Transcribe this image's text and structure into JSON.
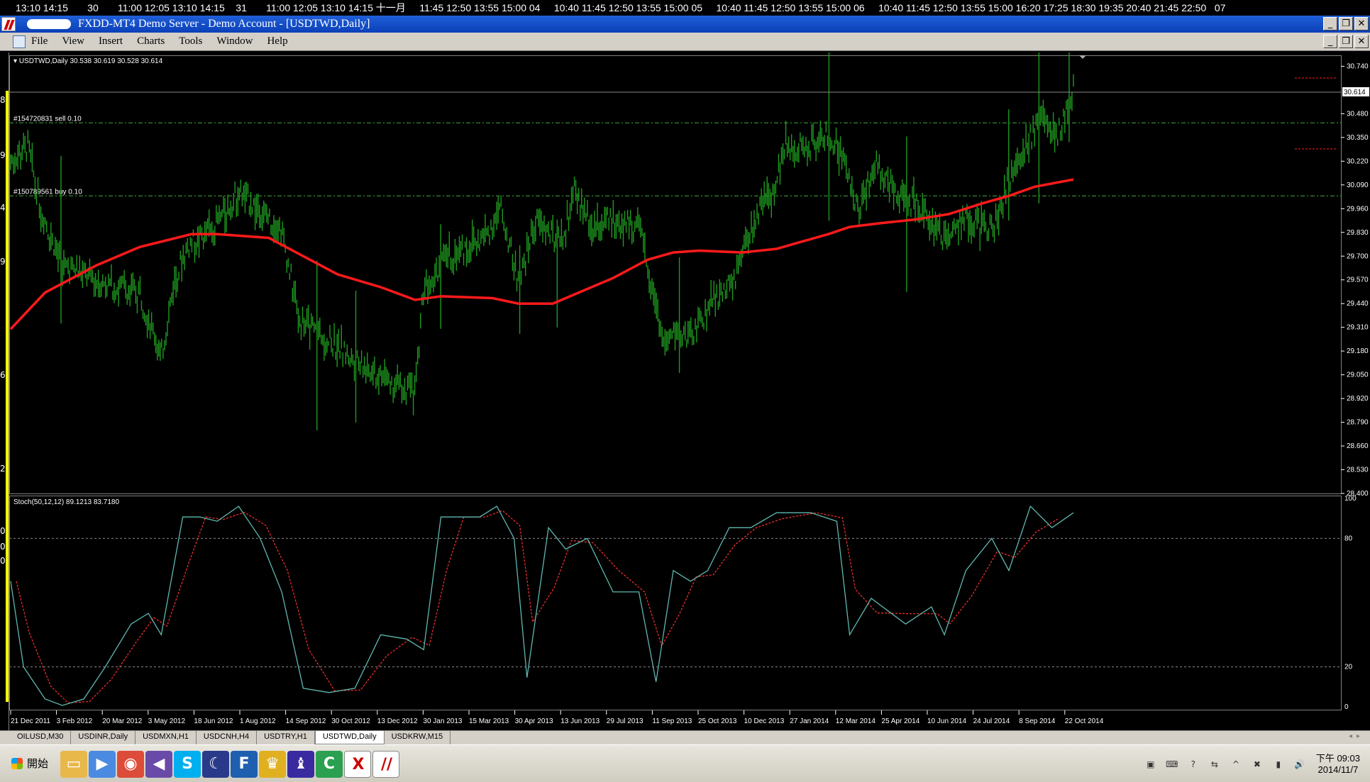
{
  "background_strip": {
    "text": "13:10 14:15       30       11:00 12:05 13:10 14:15    31       11:00 12:05 13:10 14:15 十一月     11:45 12:50 13:55 15:00 04     10:40 11:45 12:50 13:55 15:00 05     10:40 11:45 12:50 13:55 15:00 06     10:40 11:45 12:50 13:55 15:00 16:20 17:25 18:30 19:35 20:40 21:45 22:50   07"
  },
  "window": {
    "title": "FXDD-MT4 Demo Server - Demo Account - [USDTWD,Daily]",
    "buttons": [
      "_",
      "❐",
      "✕"
    ]
  },
  "menubar": {
    "items": [
      "File",
      "View",
      "Insert",
      "Charts",
      "Tools",
      "Window",
      "Help"
    ],
    "mdi_buttons": [
      "_",
      "❐",
      "✕"
    ]
  },
  "left_rail_fragments": [
    "8",
    "9",
    "4",
    "9",
    "6",
    "2",
    "0",
    "0",
    "0"
  ],
  "chart": {
    "symbol_info": "USDTWD,Daily  30.538 30.619 30.528 30.614",
    "current_price": "30.614",
    "order_lines": [
      {
        "label": "#154720831 sell 0.10",
        "price": 30.43
      },
      {
        "label": "#150789561 buy 0.10",
        "price": 30.03
      }
    ],
    "price_axis": [
      "30.740",
      "30.480",
      "30.350",
      "30.220",
      "30.090",
      "29.960",
      "29.830",
      "29.700",
      "29.570",
      "29.440",
      "29.310",
      "29.180",
      "29.050",
      "28.920",
      "28.790",
      "28.660",
      "28.530",
      "28.400"
    ],
    "colors": {
      "bars": "#1f9a1f",
      "ma": "#ff1a1a",
      "stoch_main": "#5fb8b0",
      "stoch_signal": "#ff3030",
      "grid_dash": "#3fae3f"
    }
  },
  "stochastic": {
    "info": "Stoch(50,12,12) 89.1213 83.7180",
    "axis": [
      "100",
      "80",
      "20",
      "0"
    ]
  },
  "date_axis": [
    "21 Dec 2011",
    "3 Feb 2012",
    "20 Mar 2012",
    "3 May 2012",
    "18 Jun 2012",
    "1 Aug 2012",
    "14 Sep 2012",
    "30 Oct 2012",
    "13 Dec 2012",
    "30 Jan 2013",
    "15 Mar 2013",
    "30 Apr 2013",
    "13 Jun 2013",
    "29 Jul 2013",
    "11 Sep 2013",
    "25 Oct 2013",
    "10 Dec 2013",
    "27 Jan 2014",
    "12 Mar 2014",
    "25 Apr 2014",
    "10 Jun 2014",
    "24 Jul 2014",
    "8 Sep 2014",
    "22 Oct 2014"
  ],
  "tabs": {
    "items": [
      "OILUSD,M30",
      "USDINR,Daily",
      "USDMXN,H1",
      "USDCNH,H4",
      "USDTRY,H1",
      "USDTWD,Daily",
      "USDKRW,M15"
    ],
    "active": "USDTWD,Daily"
  },
  "taskbar": {
    "start_label": "開始",
    "apps": [
      {
        "icon": "folder-icon",
        "color": "#e8b84a",
        "glyph": "▭"
      },
      {
        "icon": "media-player-icon",
        "color": "#4a8ae0",
        "glyph": "▶"
      },
      {
        "icon": "chrome-icon",
        "color": "#dd4b39",
        "glyph": "◉"
      },
      {
        "icon": "visual-studio-icon",
        "color": "#6a4aa8",
        "glyph": "◀"
      },
      {
        "icon": "skype-icon",
        "color": "#00aff0",
        "glyph": "S"
      },
      {
        "icon": "moon-app-icon",
        "color": "#2a3a8a",
        "glyph": "☾"
      },
      {
        "icon": "f-app-icon",
        "color": "#1e5fb0",
        "glyph": "F"
      },
      {
        "icon": "crown-app-icon",
        "color": "#e0b020",
        "glyph": "♛"
      },
      {
        "icon": "chess-app-icon",
        "color": "#3a2aa0",
        "glyph": "♝"
      },
      {
        "icon": "c-app-icon",
        "color": "#2aa050",
        "glyph": "C"
      },
      {
        "icon": "x-professional-icon",
        "color": "#ffffff",
        "glyph": "X"
      },
      {
        "icon": "fxdd-icon",
        "color": "#ffffff",
        "glyph": "//"
      }
    ],
    "tray": [
      "pdf-tray-icon",
      "keyboard-tray-icon",
      "help-tray-icon",
      "arrow-tray-icon",
      "expand-tray-icon",
      "red-x-tray-icon",
      "signal-tray-icon",
      "volume-tray-icon"
    ],
    "tray_glyphs": [
      "▣",
      "⌨",
      "?",
      "⇆",
      "^",
      "✖",
      "▮",
      "🔊"
    ],
    "clock_time": "下午 09:03",
    "clock_date": "2014/11/7"
  }
}
